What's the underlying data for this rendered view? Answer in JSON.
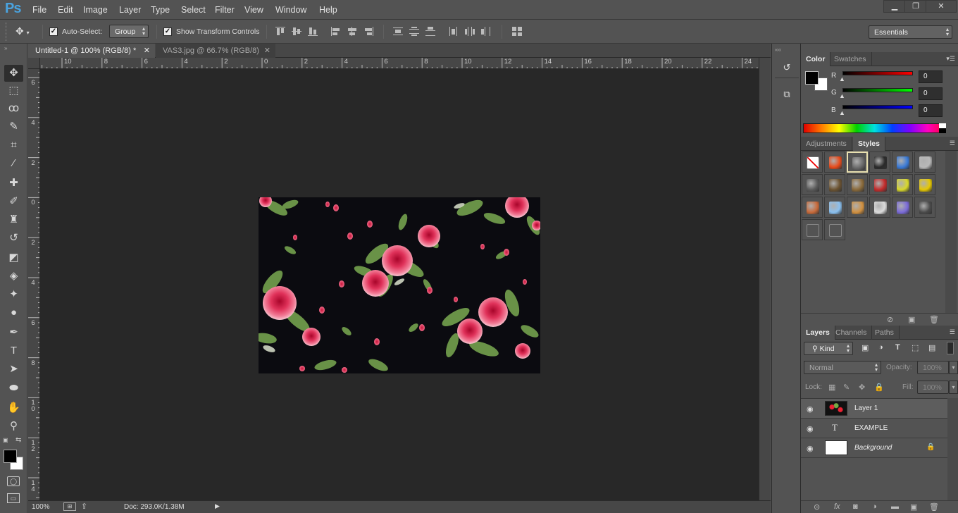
{
  "app": {
    "logo": "Ps"
  },
  "menubar": {
    "items": [
      "File",
      "Edit",
      "Image",
      "Layer",
      "Type",
      "Select",
      "Filter",
      "View",
      "Window",
      "Help"
    ],
    "win_minimize": "▁",
    "win_restore": "❐",
    "win_close": "✕"
  },
  "options": {
    "auto_select_label": "Auto-Select:",
    "auto_select_checked": true,
    "group_value": "Group",
    "show_transform_label": "Show Transform Controls",
    "show_transform_checked": true,
    "workspace": "Essentials"
  },
  "tabs": [
    {
      "label": "Untitled-1 @ 100% (RGB/8) *",
      "active": true,
      "close": "✕"
    },
    {
      "label": "VAS3.jpg @ 66.7% (RGB/8)",
      "active": false,
      "close": "✕"
    }
  ],
  "tools": [
    {
      "icon": "move-tool-icon",
      "glyph": "✥"
    },
    {
      "icon": "marquee-tool-icon",
      "glyph": "⬚"
    },
    {
      "icon": "lasso-tool-icon",
      "glyph": "ꝏ"
    },
    {
      "icon": "quick-select-tool-icon",
      "glyph": "✎"
    },
    {
      "icon": "crop-tool-icon",
      "glyph": "⌗"
    },
    {
      "icon": "eyedropper-tool-icon",
      "glyph": "⁄"
    },
    {
      "icon": "healing-brush-tool-icon",
      "glyph": "✚"
    },
    {
      "icon": "brush-tool-icon",
      "glyph": "✐"
    },
    {
      "icon": "clone-stamp-tool-icon",
      "glyph": "♜"
    },
    {
      "icon": "history-brush-tool-icon",
      "glyph": "↺"
    },
    {
      "icon": "eraser-tool-icon",
      "glyph": "◩"
    },
    {
      "icon": "paint-bucket-tool-icon",
      "glyph": "◈"
    },
    {
      "icon": "blur-tool-icon",
      "glyph": "✦"
    },
    {
      "icon": "dodge-tool-icon",
      "glyph": "●"
    },
    {
      "icon": "pen-tool-icon",
      "glyph": "✒"
    },
    {
      "icon": "type-tool-icon",
      "glyph": "T"
    },
    {
      "icon": "path-select-tool-icon",
      "glyph": "➤"
    },
    {
      "icon": "ellipse-tool-icon",
      "glyph": "⬬"
    },
    {
      "icon": "hand-tool-icon",
      "glyph": "✋"
    },
    {
      "icon": "zoom-tool-icon",
      "glyph": "⚲"
    }
  ],
  "ruler_h": [
    "10",
    "8",
    "6",
    "4",
    "2",
    "0",
    "2",
    "4",
    "6",
    "8",
    "10",
    "12",
    "14",
    "16",
    "18",
    "20",
    "22",
    "24"
  ],
  "ruler_v": [
    "6",
    "4",
    "2",
    "0",
    "2",
    "4",
    "6",
    "8",
    "1\n0",
    "1\n2",
    "1\n4"
  ],
  "statusbar": {
    "zoom": "100%",
    "doc": "Doc: 293.0K/1.38M"
  },
  "color_panel": {
    "tabs": [
      "Color",
      "Swatches"
    ],
    "channels": [
      {
        "label": "R",
        "value": "0"
      },
      {
        "label": "G",
        "value": "0"
      },
      {
        "label": "B",
        "value": "0"
      }
    ],
    "foreground": "#000000",
    "background": "#ffffff"
  },
  "styles_panel": {
    "tabs": [
      "Adjustments",
      "Styles"
    ],
    "swatches": [
      "#ffffff",
      "#e84a1a",
      "#6a6a6a",
      "#2a2a2a",
      "#3a7ad6",
      "#b8b8b8",
      "#5a5a5a",
      "#6b5230",
      "#8a6a3a",
      "#c42a2a",
      "#d8d82a",
      "#e6c800",
      "#c86a3a",
      "#8ac0f0",
      "#d09040",
      "#dcdcdc",
      "#7a6ad8",
      "#4a4a4a",
      "#535353",
      "#535353"
    ]
  },
  "layers_panel": {
    "tabs": [
      "Layers",
      "Channels",
      "Paths"
    ],
    "filter_kind": "Kind",
    "blend_mode": "Normal",
    "opacity_label": "Opacity:",
    "opacity_value": "100%",
    "lock_label": "Lock:",
    "fill_label": "Fill:",
    "fill_value": "100%",
    "layers": [
      {
        "name": "Layer 1",
        "type": "image",
        "visible": true
      },
      {
        "name": "EXAMPLE",
        "type": "text",
        "visible": true
      },
      {
        "name": "Background",
        "type": "fill",
        "visible": true,
        "locked": true
      }
    ],
    "eye_glyph": "◉",
    "text_glyph": "T",
    "lock_glyph": "🔒"
  }
}
